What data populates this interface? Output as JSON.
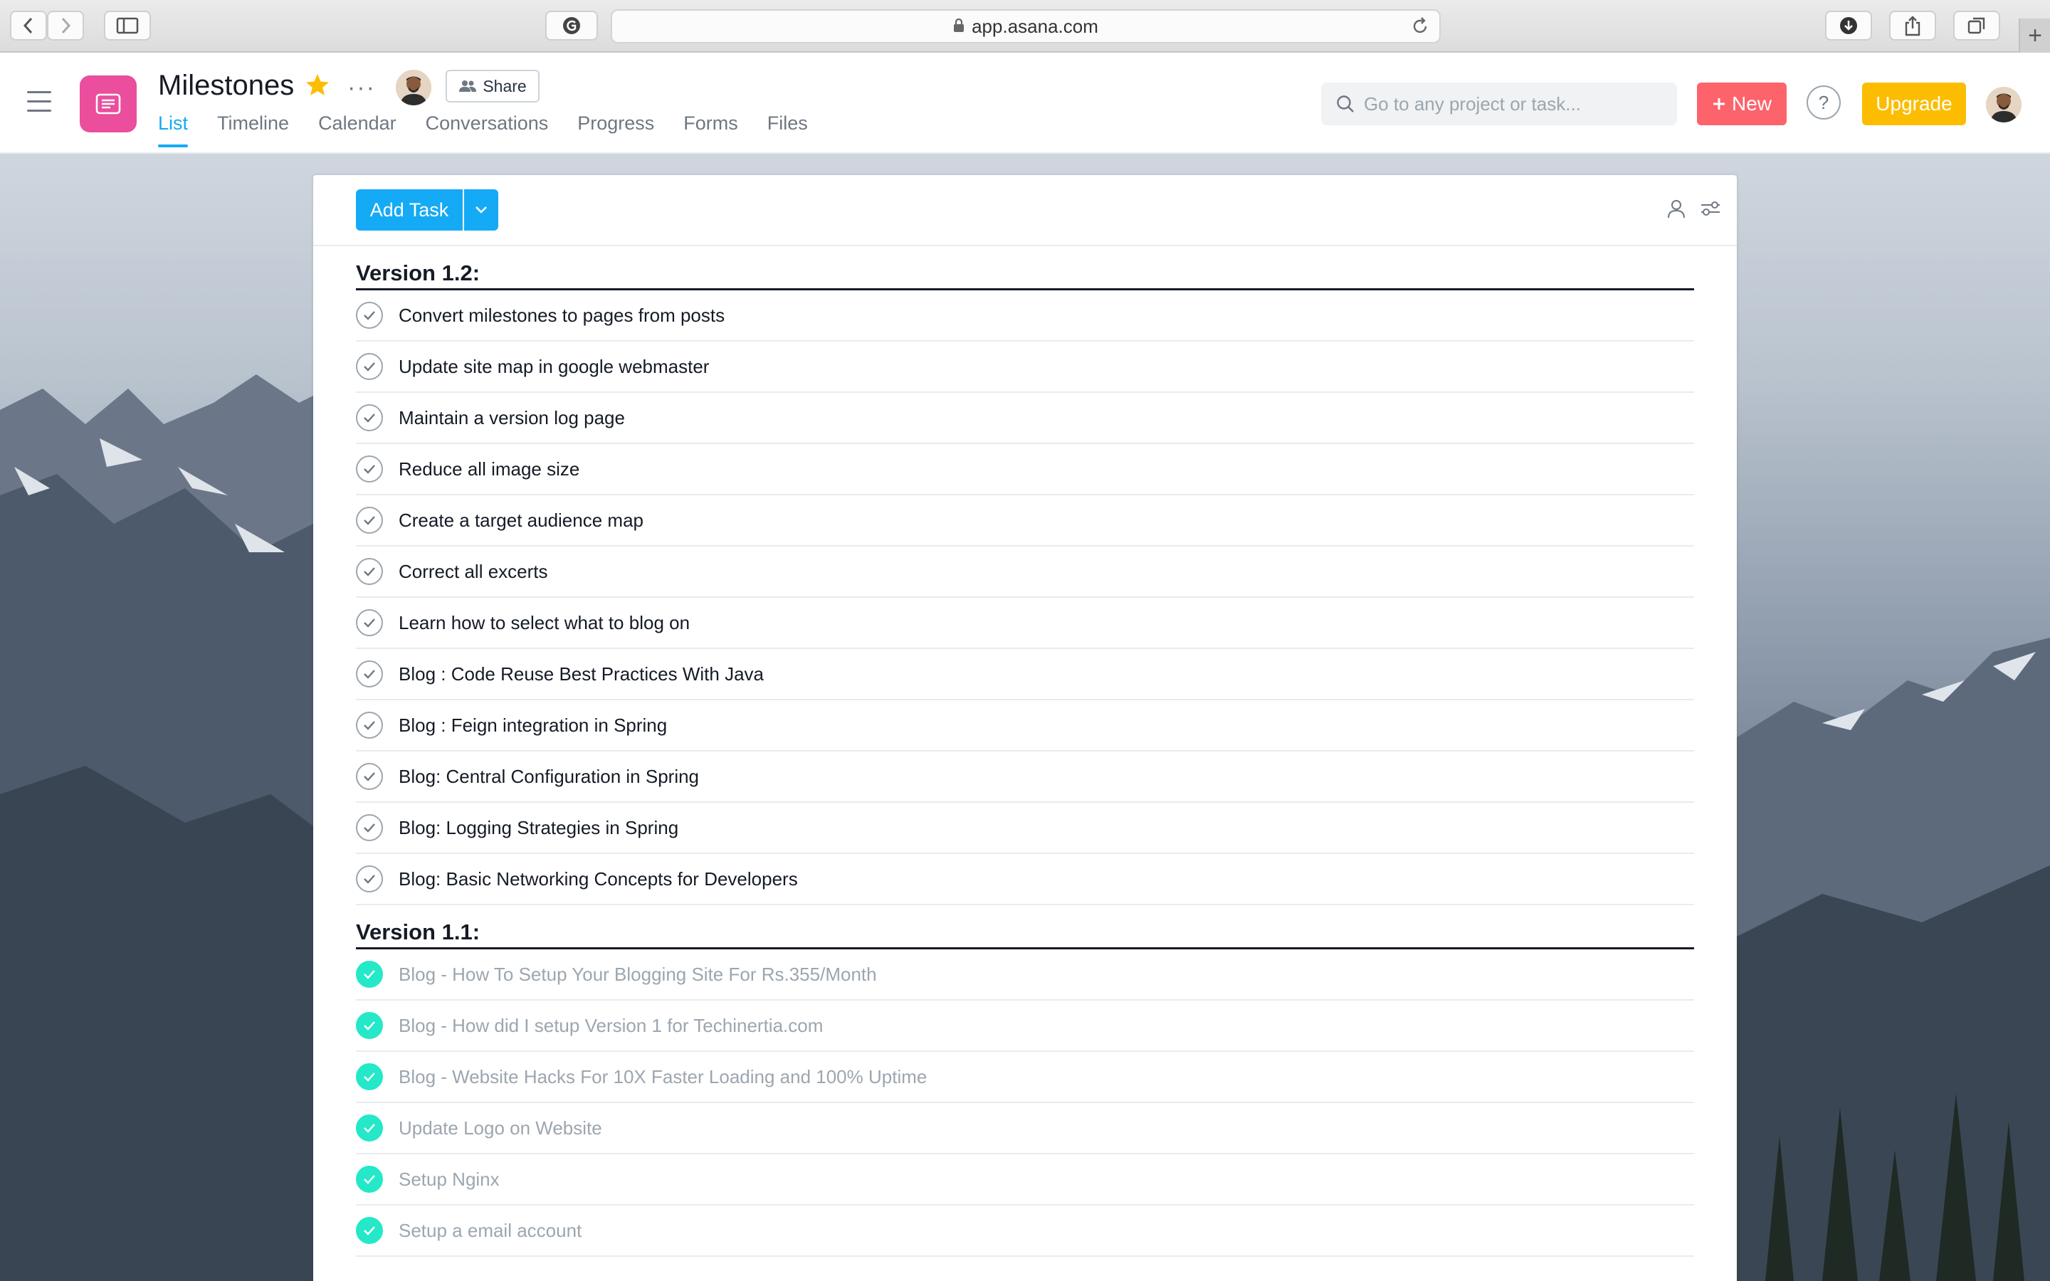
{
  "browser": {
    "url": "app.asana.com",
    "new_tab": "+"
  },
  "header": {
    "project_title": "Milestones",
    "more": "···",
    "share_label": "Share",
    "tabs": [
      {
        "label": "List",
        "active": true
      },
      {
        "label": "Timeline",
        "active": false
      },
      {
        "label": "Calendar",
        "active": false
      },
      {
        "label": "Conversations",
        "active": false
      },
      {
        "label": "Progress",
        "active": false
      },
      {
        "label": "Forms",
        "active": false
      },
      {
        "label": "Files",
        "active": false
      }
    ],
    "search_placeholder": "Go to any project or task...",
    "new_label": "New",
    "help_label": "?",
    "upgrade_label": "Upgrade"
  },
  "colors": {
    "project_icon": "#ea4e9d",
    "accent": "#14aaf5",
    "new_button": "#fc636b",
    "upgrade_button": "#fcbd01",
    "complete_check": "#25e8c8"
  },
  "toolbar": {
    "add_task_label": "Add Task"
  },
  "sections": [
    {
      "title": "Version 1.2:",
      "tasks": [
        {
          "name": "Convert milestones to pages from posts",
          "completed": false
        },
        {
          "name": "Update site map in google webmaster",
          "completed": false
        },
        {
          "name": "Maintain a version log page",
          "completed": false
        },
        {
          "name": "Reduce all image size",
          "completed": false
        },
        {
          "name": "Create a target audience map",
          "completed": false
        },
        {
          "name": "Correct all excerts",
          "completed": false
        },
        {
          "name": "Learn how to select what to blog on",
          "completed": false
        },
        {
          "name": "Blog : Code Reuse Best Practices With Java",
          "completed": false
        },
        {
          "name": "Blog : Feign integration in Spring",
          "completed": false
        },
        {
          "name": "Blog: Central Configuration in Spring",
          "completed": false
        },
        {
          "name": "Blog: Logging Strategies in Spring",
          "completed": false
        },
        {
          "name": "Blog: Basic Networking Concepts for Developers",
          "completed": false
        }
      ]
    },
    {
      "title": "Version 1.1:",
      "tasks": [
        {
          "name": "Blog - How To Setup Your Blogging Site For Rs.355/Month",
          "completed": true
        },
        {
          "name": "Blog - How did I setup Version 1 for Techinertia.com",
          "completed": true
        },
        {
          "name": "Blog - Website Hacks For 10X Faster Loading and 100% Uptime",
          "completed": true
        },
        {
          "name": "Update Logo on Website",
          "completed": true
        },
        {
          "name": "Setup Nginx",
          "completed": true
        },
        {
          "name": "Setup a email account",
          "completed": true
        }
      ]
    }
  ]
}
